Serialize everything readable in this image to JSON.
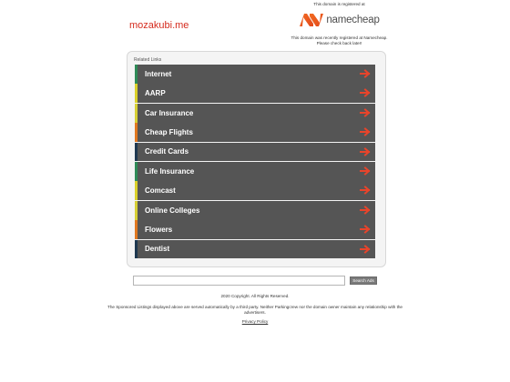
{
  "header": {
    "domain": "mozakubi.me",
    "registered_at_text": "This domain is registered at",
    "registrar_name": "namecheap",
    "recent_note_line1": "This domain was recently registered at Namecheap.",
    "recent_note_line2": "Please check back later!"
  },
  "related": {
    "title": "Related Links",
    "links": [
      {
        "label": "Internet",
        "accent": "#2e8b57"
      },
      {
        "label": "AARP",
        "accent": "#d9d02a"
      },
      {
        "label": "Car Insurance",
        "accent": "#d6cf35"
      },
      {
        "label": "Cheap Flights",
        "accent": "#e07820"
      },
      {
        "label": "Credit Cards",
        "accent": "#1e3850"
      },
      {
        "label": "Life Insurance",
        "accent": "#2e8b57"
      },
      {
        "label": "Comcast",
        "accent": "#d9d02a"
      },
      {
        "label": "Online Colleges",
        "accent": "#d6cf35"
      },
      {
        "label": "Flowers",
        "accent": "#e07820"
      },
      {
        "label": "Dentist",
        "accent": "#1e3850"
      }
    ],
    "arrow_icon": "right-arrow-icon",
    "arrow_color": "#e8442b"
  },
  "search": {
    "placeholder": "",
    "value": "",
    "button_label": "Search Ads"
  },
  "footer": {
    "copyright": "2020 Copyright. All Rights Reserved.",
    "disclaimer_line1": "The Sponsored Listings displayed above are served automatically by a third party. Neither Parkingcrew nor the domain owner maintain any relationship with the",
    "disclaimer_line2": "advertisers.",
    "privacy_label": "Privacy Policy"
  },
  "colors": {
    "domain_text": "#d52b1e",
    "logo_orange": "#f26b21",
    "row_background": "#555555"
  }
}
